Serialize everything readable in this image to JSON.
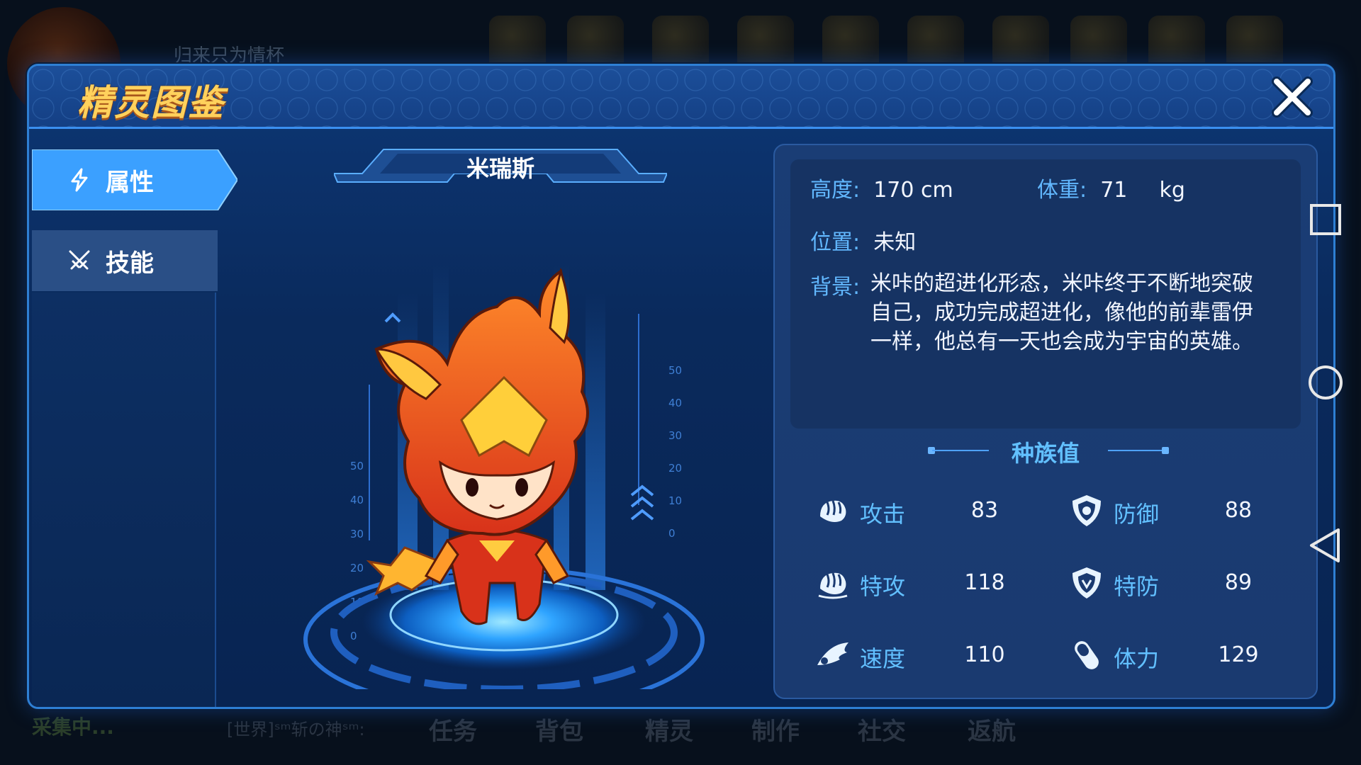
{
  "background": {
    "player_name": "归来只为情杯",
    "bottom_menu": [
      "任务",
      "背包",
      "精灵",
      "制作",
      "社交",
      "返航"
    ],
    "chat_text": "[世界]ˢᵐ斩の神ˢᵐ:",
    "collect_text": "采集中..."
  },
  "dialog": {
    "title": "精灵图鉴",
    "tabs": [
      {
        "label": "属性",
        "icon": "lightning-icon",
        "active": true
      },
      {
        "label": "技能",
        "icon": "swords-icon",
        "active": false
      }
    ],
    "creature_name": "米瑞斯",
    "info": {
      "height_label": "高度:",
      "height_value": "170 cm",
      "weight_label": "体重:",
      "weight_value": "71",
      "weight_unit": "kg",
      "location_label": "位置:",
      "location_value": "未知",
      "background_label": "背景:",
      "background_text": "米咔的超进化形态，米咔终于不断地突破自己，成功完成超进化，像他的前辈雷伊一样，他总有一天也会成为宇宙的英雄。"
    },
    "stats_title": "种族值",
    "stats": [
      {
        "label": "攻击",
        "value": "83",
        "icon": "attack-fist-icon"
      },
      {
        "label": "防御",
        "value": "88",
        "icon": "defense-shield-icon"
      },
      {
        "label": "特攻",
        "value": "118",
        "icon": "special-attack-fist-icon"
      },
      {
        "label": "特防",
        "value": "89",
        "icon": "special-defense-shield-icon"
      },
      {
        "label": "速度",
        "value": "110",
        "icon": "speed-wing-icon"
      },
      {
        "label": "体力",
        "value": "129",
        "icon": "stamina-capsule-icon"
      }
    ],
    "gauge_ticks_left": [
      "50",
      "40",
      "30",
      "20",
      "10",
      "0"
    ],
    "gauge_ticks_right": [
      "50",
      "40",
      "30",
      "20",
      "10",
      "0"
    ]
  },
  "colors": {
    "accent_blue": "#2e7fd4",
    "title_gold": "#ffd15c",
    "label_blue": "#62b8ff"
  }
}
